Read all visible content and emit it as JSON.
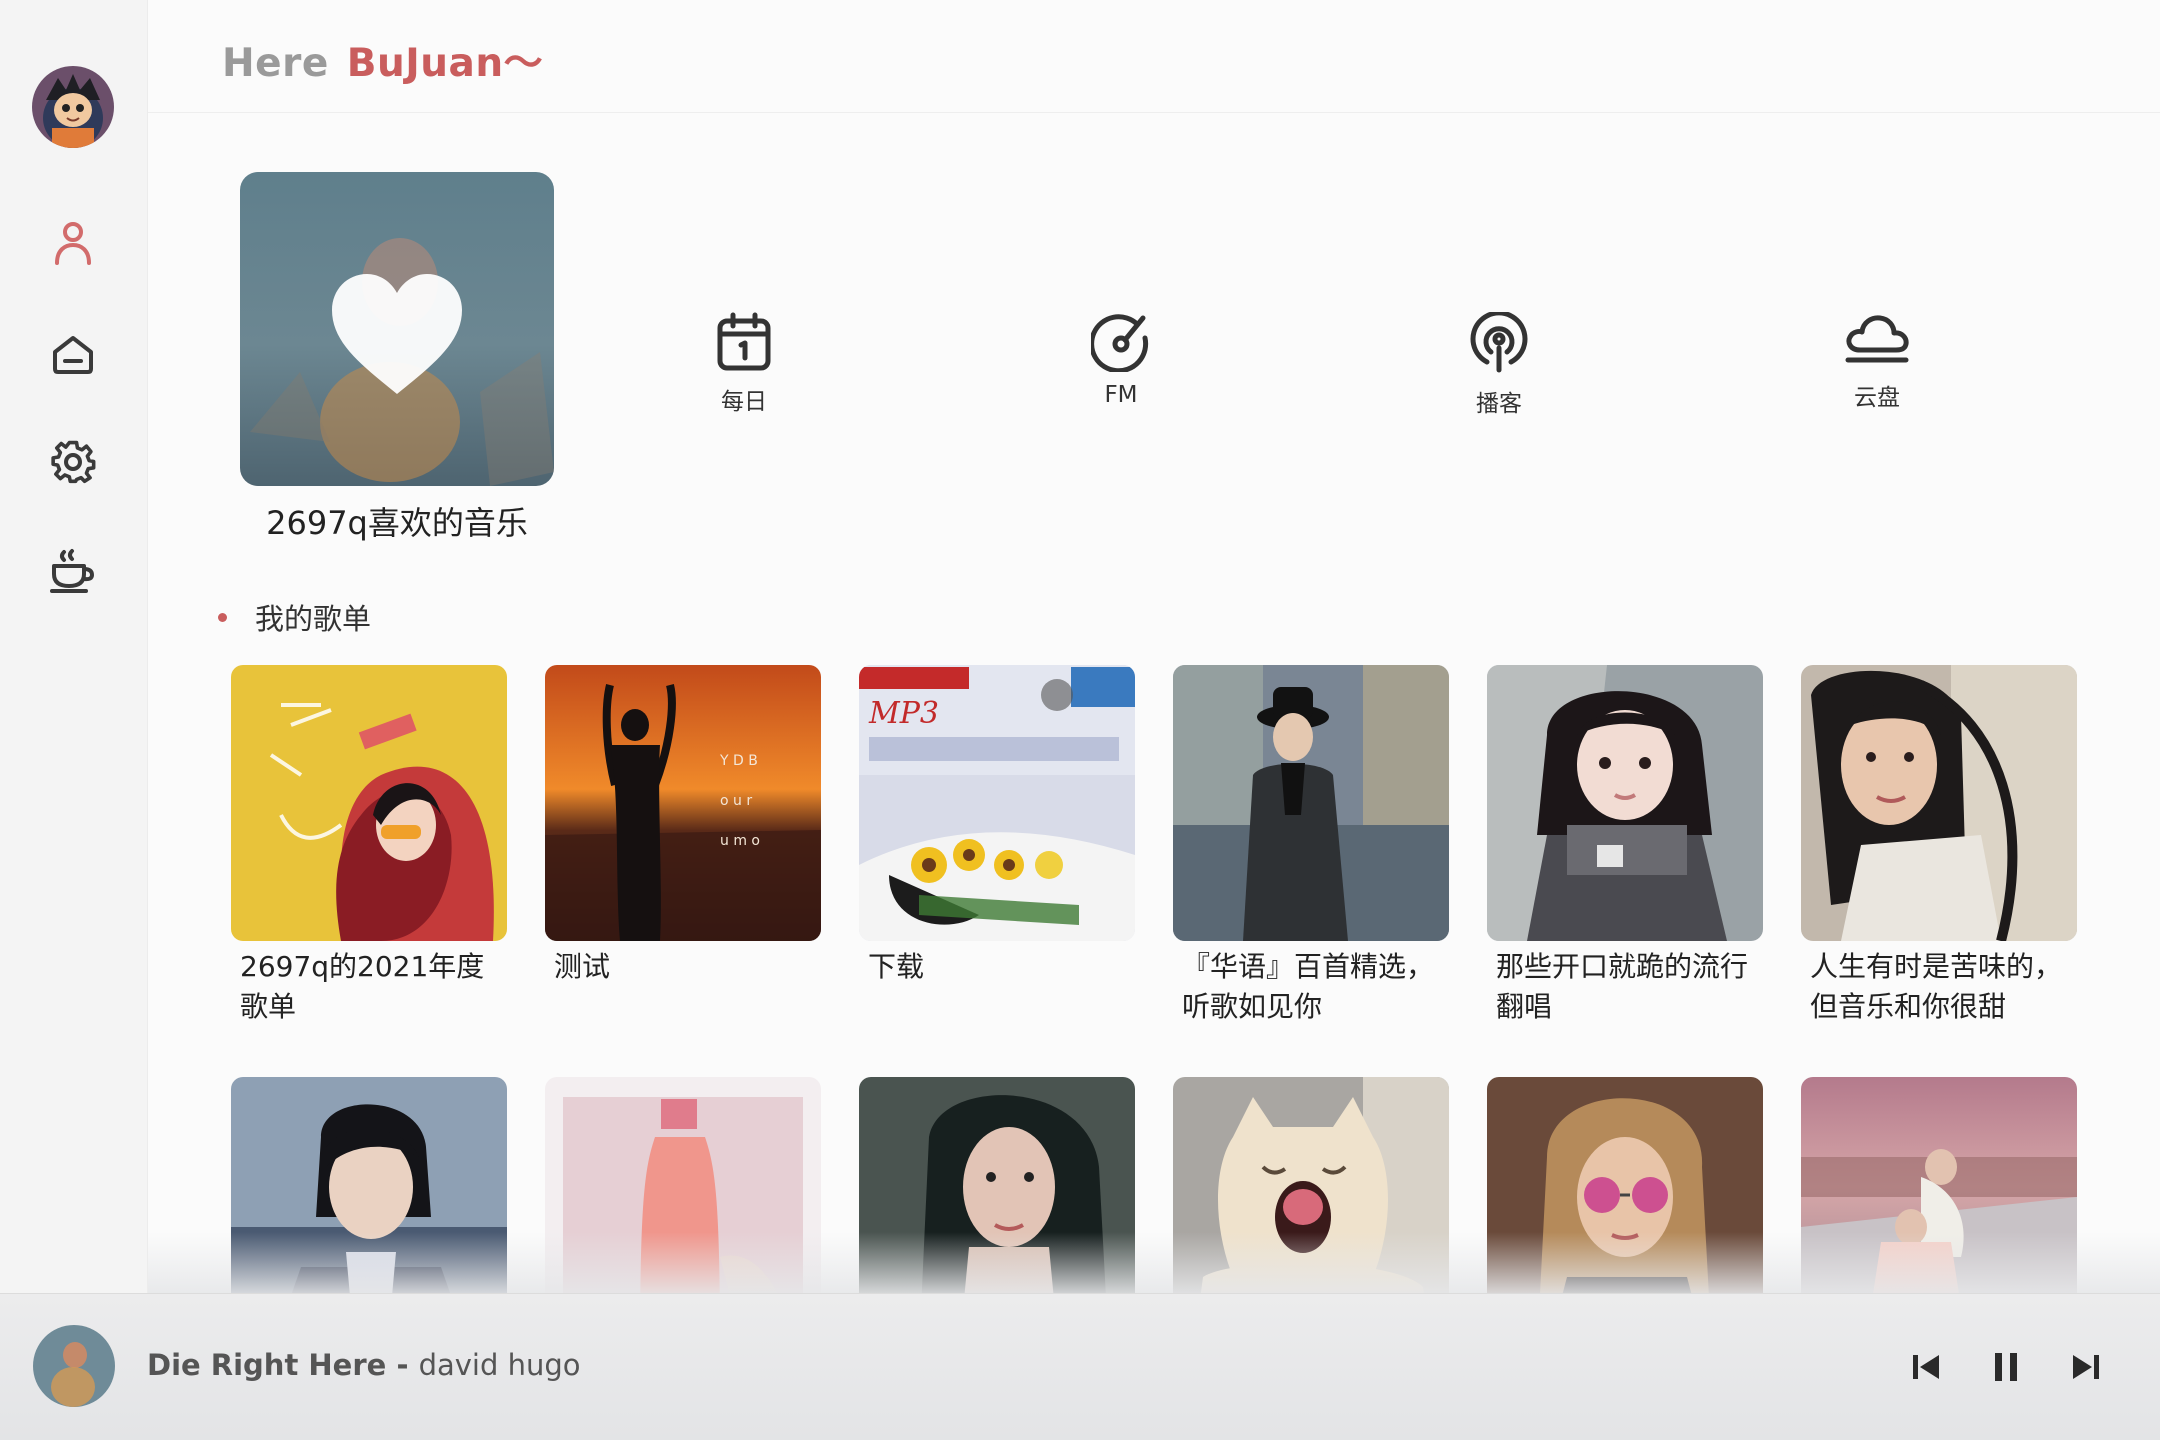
{
  "header": {
    "greeting": "Here",
    "username": "BuJuan～"
  },
  "sidebar": {
    "items": [
      {
        "name": "user-icon"
      },
      {
        "name": "home-icon"
      },
      {
        "name": "gear-icon"
      },
      {
        "name": "coffee-icon"
      }
    ]
  },
  "liked": {
    "title": "2697q喜欢的音乐"
  },
  "quick_entries": [
    {
      "label": "每日",
      "icon": "calendar-icon"
    },
    {
      "label": "FM",
      "icon": "radio-disc-icon"
    },
    {
      "label": "播客",
      "icon": "podcast-icon"
    },
    {
      "label": "云盘",
      "icon": "cloud-icon"
    }
  ],
  "section": {
    "title": "我的歌单"
  },
  "playlists": [
    {
      "title": "2697q的2021年度歌单"
    },
    {
      "title": "测试"
    },
    {
      "title": "下载"
    },
    {
      "title": "『华语』百首精选，听歌如见你"
    },
    {
      "title": "那些开口就跪的流行翻唱"
    },
    {
      "title": "人生有时是苦味的，但音乐和你很甜"
    },
    {
      "title": ""
    },
    {
      "title": ""
    },
    {
      "title": ""
    },
    {
      "title": ""
    },
    {
      "title": ""
    },
    {
      "title": ""
    }
  ],
  "player": {
    "song": "Die Right Here",
    "separator": "-",
    "artist": "david hugo"
  },
  "colors": {
    "accent": "#c95d5d",
    "sidebar_bg": "#f4f4f4"
  }
}
